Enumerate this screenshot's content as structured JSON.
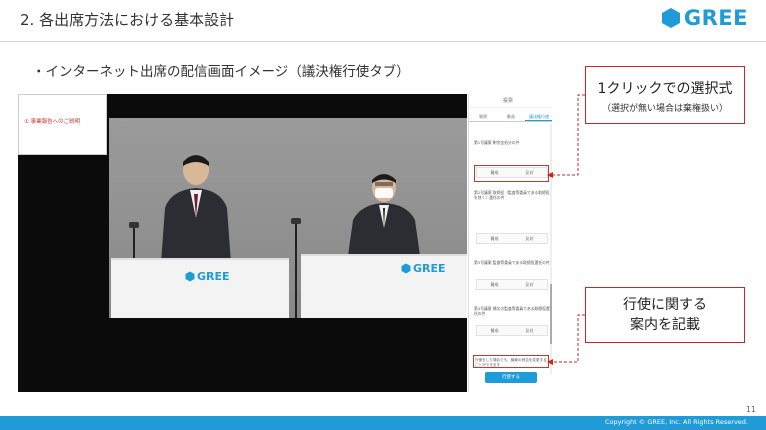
{
  "header": {
    "title": "2. 各出席方法における基本設計",
    "logo_text": "GREE"
  },
  "subtitle": "・インターネット出席の配信画面イメージ（議決権行使タブ）",
  "video": {
    "side_banner": "① 事業報告へのご説明",
    "podium_logo_text": "GREE"
  },
  "phone": {
    "title": "投票",
    "tabs": [
      "質問",
      "動画",
      "議決権行使"
    ],
    "items": [
      {
        "text": "第1号議案 剰余金処分の件",
        "approve": "賛成",
        "oppose": "反対"
      },
      {
        "text": "第2号議案 取締役（監査等委員である取締役を除く）選任の件",
        "approve": "賛成",
        "oppose": "反対"
      },
      {
        "text": "第3号議案 監査等委員である取締役選任の件",
        "approve": "賛成",
        "oppose": "反対"
      },
      {
        "text": "第4号議案 補欠の監査等委員である取締役選任の件",
        "approve": "賛成",
        "oppose": "反対"
      }
    ],
    "notice": "行使をした場合でも、議案の賛否を変更することができます",
    "submit": "行使する"
  },
  "callouts": {
    "one_click_main": "1クリックでの選択式",
    "one_click_sub": "（選択が無い場合は棄権扱い）",
    "guidance_line1": "行使に関する",
    "guidance_line2": "案内を記載"
  },
  "footer": {
    "page_number": "11",
    "copyright": "Copyright © GREE, Inc. All Rights Reserved."
  },
  "colors": {
    "brand": "#1f9bd7",
    "callout_border": "#c62828"
  }
}
